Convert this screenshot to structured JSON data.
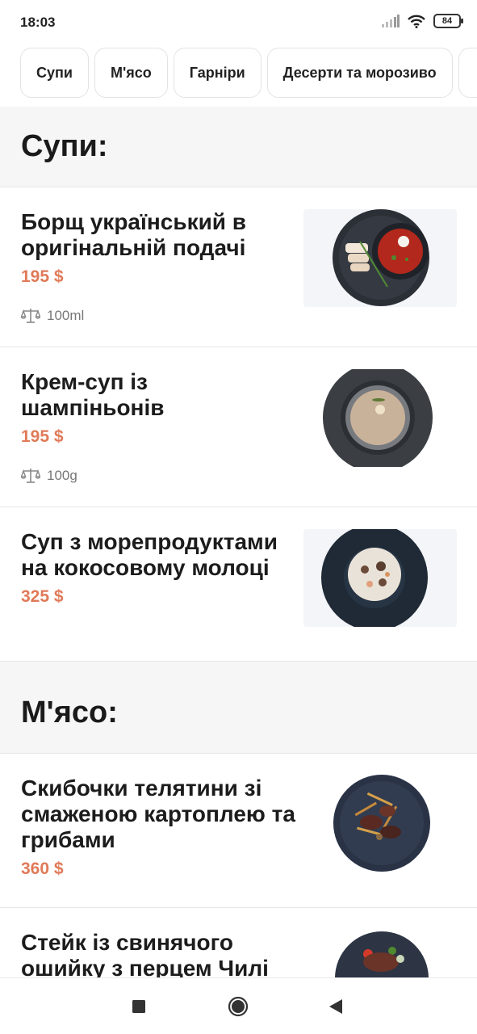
{
  "status": {
    "time": "18:03",
    "battery": "84"
  },
  "tabs": [
    {
      "label": "Супи"
    },
    {
      "label": "М'ясо"
    },
    {
      "label": "Гарніри"
    },
    {
      "label": "Десерти та морозиво"
    }
  ],
  "sections": [
    {
      "title": "Супи:",
      "items": [
        {
          "name": "Борщ український в оригінальній подачі",
          "price": "195 $",
          "weight": "100ml",
          "photo": "borscht-photo"
        },
        {
          "name": "Крем-суп із шампіньонів",
          "price": "195 $",
          "weight": "100g",
          "photo": "mushroom-cream-soup-photo"
        },
        {
          "name": "Суп з морепродуктами на кокосовому молоці",
          "price": "325 $",
          "photo": "seafood-coconut-soup-photo"
        }
      ]
    },
    {
      "title": "М'ясо:",
      "items": [
        {
          "name": "Скибочки телятини зі смаженою картоплею та грибами",
          "price": "360 $",
          "photo": "veal-potatoes-photo"
        },
        {
          "name": "Стейк із свинячого ошийку з перцем Чилі",
          "photo": "pork-steak-photo"
        }
      ]
    }
  ],
  "icons": {
    "weight": "scale-icon",
    "signal": "signal-icon",
    "wifi": "wifi-icon",
    "battery": "battery-icon",
    "nav_recent": "square-icon",
    "nav_home": "circle-icon",
    "nav_back": "back-triangle-icon"
  },
  "colors": {
    "price": "#e07a58",
    "section_bg": "#f6f6f6",
    "divider": "#e6e6e6"
  }
}
